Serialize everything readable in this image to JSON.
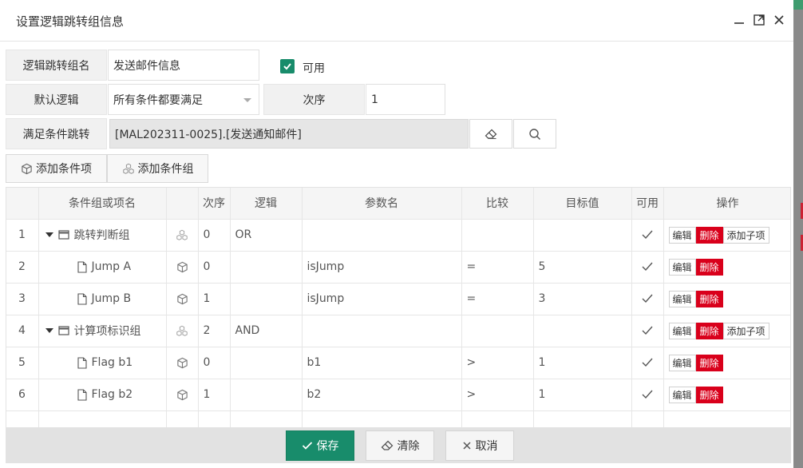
{
  "dialog": {
    "title": "设置逻辑跳转组信息"
  },
  "form": {
    "group_name_label": "逻辑跳转组名",
    "group_name_value": "发送邮件信息",
    "enabled_label": "可用",
    "enabled_checked": true,
    "default_logic_label": "默认逻辑",
    "default_logic_value": "所有条件都要满足",
    "order_label": "次序",
    "order_value": "1",
    "jump_label": "满足条件跳转",
    "jump_value": "[MAL202311-0025].[发送通知邮件]"
  },
  "toolbar": {
    "add_item_label": "添加条件项",
    "add_group_label": "添加条件组"
  },
  "table": {
    "headers": [
      "",
      "条件组或项名",
      "",
      "次序",
      "逻辑",
      "参数名",
      "比较",
      "目标值",
      "可用",
      "操作"
    ],
    "op_labels": {
      "edit": "编辑",
      "delete": "删除",
      "add_child": "添加子项"
    },
    "rows": [
      {
        "index": "1",
        "name": "跳转判断组",
        "kind": "group",
        "order": "0",
        "logic": "OR",
        "param": "",
        "compare": "",
        "target": "",
        "enabled": true
      },
      {
        "index": "2",
        "name": "Jump A",
        "kind": "item",
        "order": "0",
        "logic": "",
        "param": "isJump",
        "compare": "=",
        "target": "5",
        "enabled": true
      },
      {
        "index": "3",
        "name": "Jump B",
        "kind": "item",
        "order": "1",
        "logic": "",
        "param": "isJump",
        "compare": "=",
        "target": "3",
        "enabled": true
      },
      {
        "index": "4",
        "name": "计算项标识组",
        "kind": "group",
        "order": "2",
        "logic": "AND",
        "param": "",
        "compare": "",
        "target": "",
        "enabled": true
      },
      {
        "index": "5",
        "name": "Flag b1",
        "kind": "item",
        "order": "0",
        "logic": "",
        "param": "b1",
        "compare": ">",
        "target": "1",
        "enabled": true
      },
      {
        "index": "6",
        "name": "Flag b2",
        "kind": "item",
        "order": "1",
        "logic": "",
        "param": "b2",
        "compare": ">",
        "target": "1",
        "enabled": true
      }
    ]
  },
  "footer": {
    "save_label": "保存",
    "clear_label": "清除",
    "cancel_label": "取消"
  },
  "colors": {
    "primary": "#188c6b",
    "danger": "#d9001b"
  }
}
